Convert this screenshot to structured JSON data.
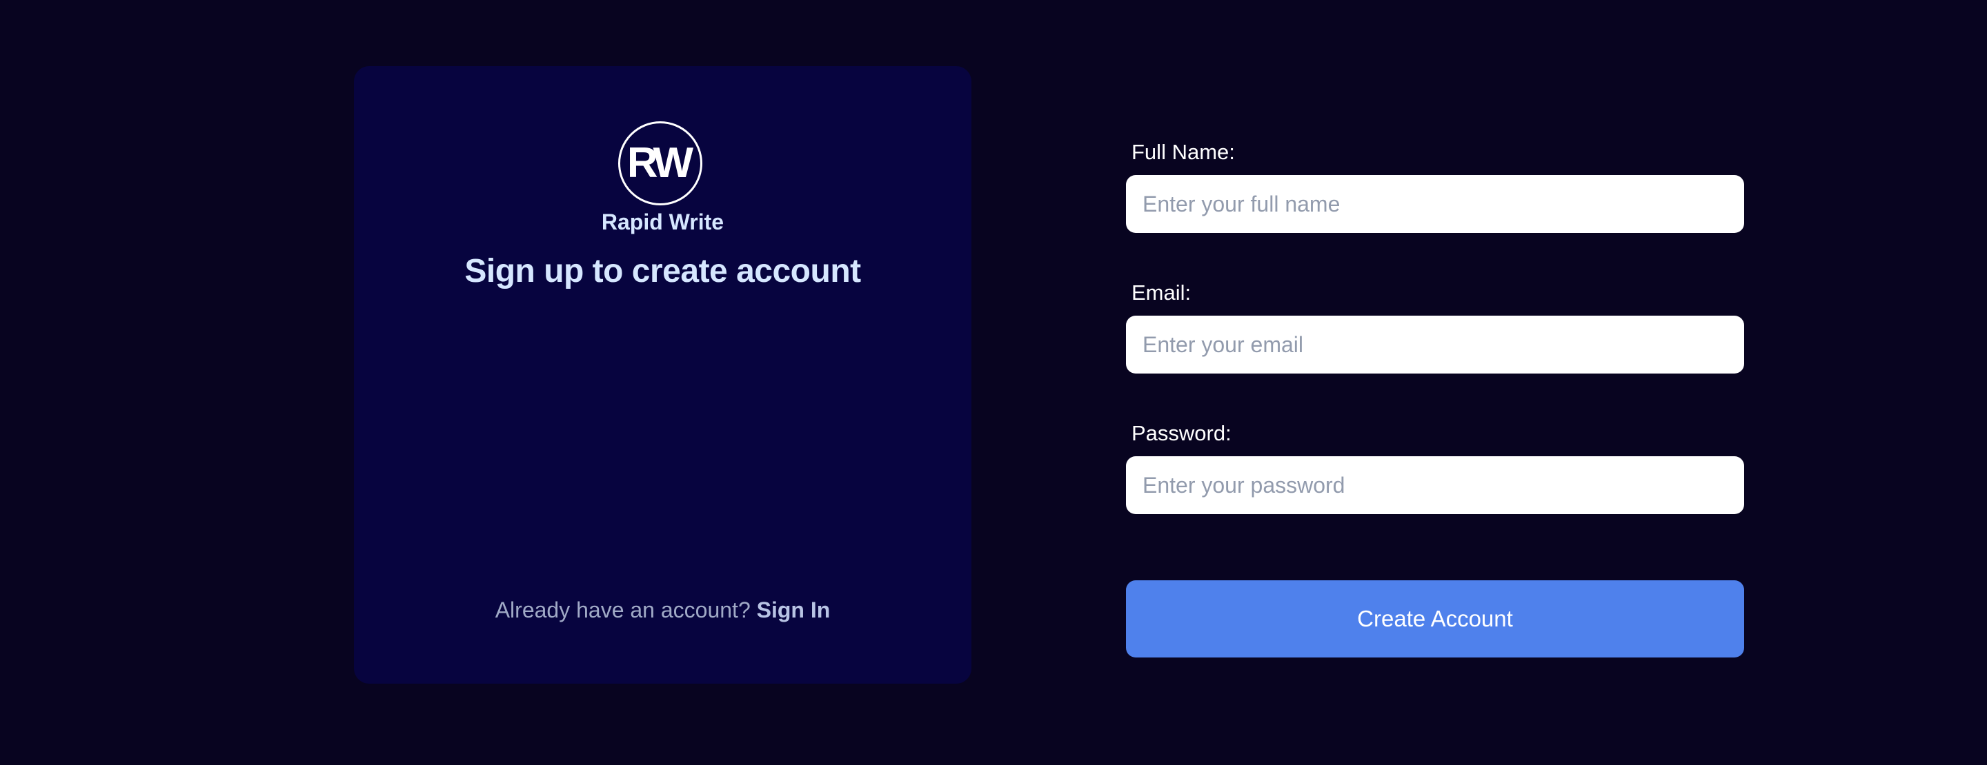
{
  "brand": {
    "logo_text": "RW",
    "app_name": "Rapid Write",
    "heading": "Sign up to create account",
    "signin_prompt": "Already have an account?",
    "signin_link": "Sign In"
  },
  "form": {
    "full_name": {
      "label": "Full Name:",
      "placeholder": "Enter your full name",
      "value": ""
    },
    "email": {
      "label": "Email:",
      "placeholder": "Enter your email",
      "value": ""
    },
    "password": {
      "label": "Password:",
      "placeholder": "Enter your password",
      "value": ""
    },
    "submit_label": "Create Account"
  },
  "colors": {
    "background": "#080420",
    "panel": "#07043f",
    "heading_text": "#d6e7ff",
    "button": "#4f81ec"
  }
}
